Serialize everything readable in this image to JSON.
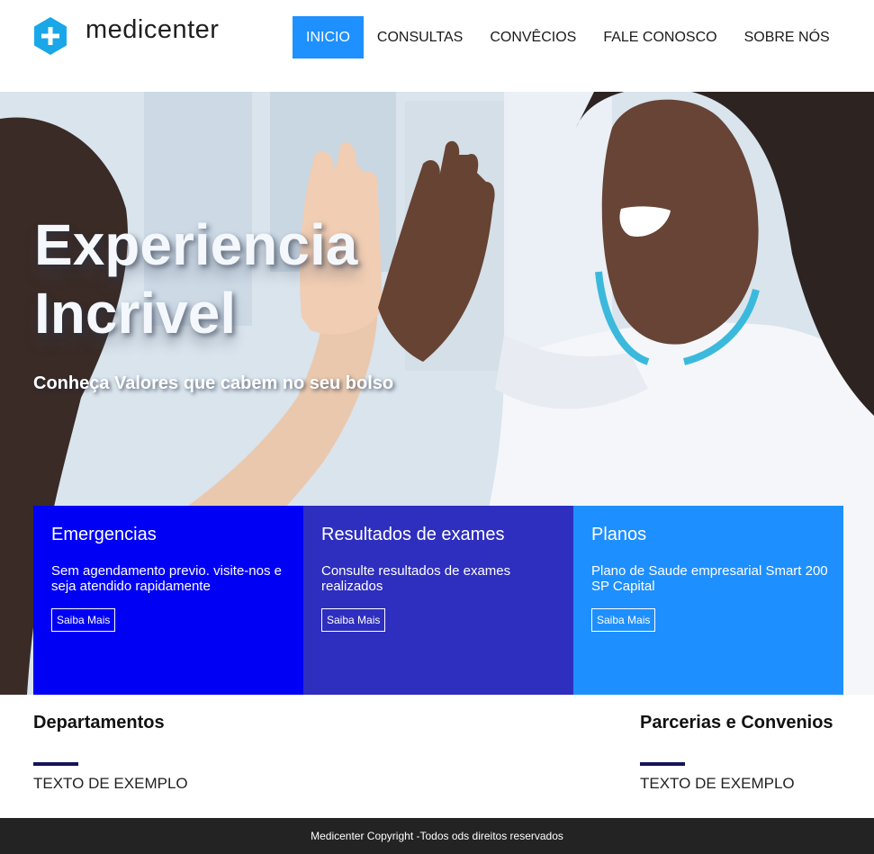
{
  "brand": {
    "name": "medicenter",
    "accent": "#1e90ff"
  },
  "nav": {
    "items": [
      {
        "label": "INICIO",
        "active": true
      },
      {
        "label": "CONSULTAS",
        "active": false
      },
      {
        "label": "CONVÊCIOS",
        "active": false
      },
      {
        "label": "FALE CONOSCO",
        "active": false
      },
      {
        "label": "SOBRE NÓS",
        "active": false
      }
    ]
  },
  "hero": {
    "title_line1": "Experiencia",
    "title_line2": "Incrivel",
    "subtitle": "Conheça Valores que cabem no seu bolso"
  },
  "cards": [
    {
      "title": "Emergencias",
      "text": "Sem agendamento previo. visite-nos e seja atendido rapidamente",
      "button": "Saiba Mais",
      "color": "#0000f5"
    },
    {
      "title": "Resultados de exames",
      "text": "Consulte resultados de exames realizados",
      "button": "Saiba Mais",
      "color": "#2e2ebf"
    },
    {
      "title": "Planos",
      "text": "Plano de Saude empresarial Smart 200 SP Capital",
      "button": "Saiba Mais",
      "color": "#1e8fff"
    }
  ],
  "sections": {
    "left": {
      "title": "Departamentos",
      "text": "TEXTO DE EXEMPLO"
    },
    "right": {
      "title": "Parcerias e Convenios",
      "text": "TEXTO DE EXEMPLO"
    }
  },
  "footer": {
    "text": "Medicenter Copyright -Todos ods direitos reservados"
  }
}
